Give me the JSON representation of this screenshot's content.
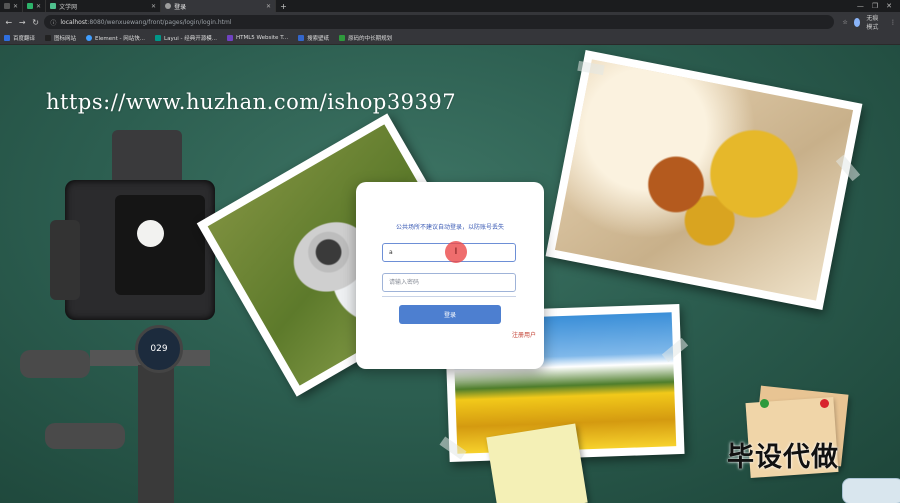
{
  "browser": {
    "tabs": [
      {
        "title": "",
        "favicon_color": "#555555",
        "active": false
      },
      {
        "title": "",
        "favicon_color": "#2db36a",
        "active": false
      },
      {
        "title": "文学网",
        "favicon_color": "#4fc08d",
        "active": false
      },
      {
        "title": "登录",
        "favicon_color": "#9e9e9e",
        "active": true
      }
    ],
    "new_tab_label": "+",
    "url_host": "localhost",
    "url_path": ":8080/wenxuewang/front/pages/login/login.html",
    "profile_label": "无痕模式",
    "window_controls": [
      "—",
      "❐",
      "✕"
    ]
  },
  "bookmarks": [
    {
      "label": "百度翻译",
      "icon_color": "#2f6fe0"
    },
    {
      "label": "图标网站",
      "icon_color": "#222222"
    },
    {
      "label": "Element - 网站快...",
      "icon_color": "#409eff"
    },
    {
      "label": "Layui - 经典开源模...",
      "icon_color": "#009688"
    },
    {
      "label": "HTML5 Website T...",
      "icon_color": "#6f42c1"
    },
    {
      "label": "搜索壁纸",
      "icon_color": "#3366cc"
    },
    {
      "label": "原码的中长期规划",
      "icon_color": "#2e9a3c"
    }
  ],
  "page": {
    "watermark": "https://www.huzhan.com/ishop39397",
    "promo_text": "毕设代做",
    "camera_dial": "029"
  },
  "login": {
    "tip": "公共场所不建议自动登录，以防账号丢失",
    "username_value": "a",
    "password_placeholder": "请输入密码",
    "submit_label": "登录",
    "register_label": "注册用户"
  },
  "colors": {
    "board": "#2c5e50",
    "button": "#4d7fd0",
    "register": "#c0392b",
    "tip": "#3b5bb5"
  }
}
